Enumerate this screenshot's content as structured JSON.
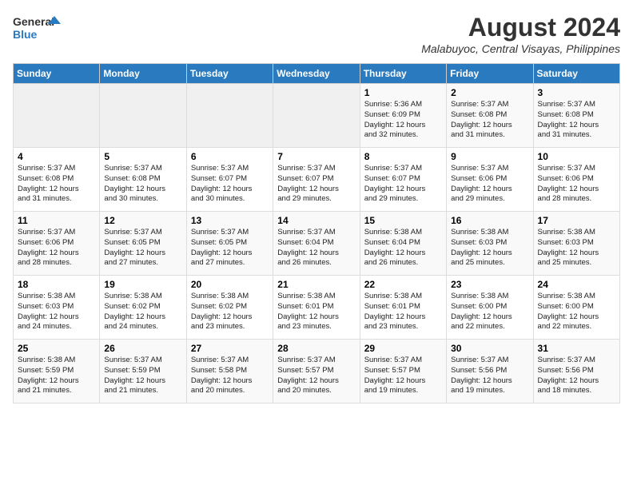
{
  "header": {
    "logo_line1": "General",
    "logo_line2": "Blue",
    "month_year": "August 2024",
    "location": "Malabuyoc, Central Visayas, Philippines"
  },
  "weekdays": [
    "Sunday",
    "Monday",
    "Tuesday",
    "Wednesday",
    "Thursday",
    "Friday",
    "Saturday"
  ],
  "weeks": [
    [
      {
        "day": "",
        "info": ""
      },
      {
        "day": "",
        "info": ""
      },
      {
        "day": "",
        "info": ""
      },
      {
        "day": "",
        "info": ""
      },
      {
        "day": "1",
        "info": "Sunrise: 5:36 AM\nSunset: 6:09 PM\nDaylight: 12 hours\nand 32 minutes."
      },
      {
        "day": "2",
        "info": "Sunrise: 5:37 AM\nSunset: 6:08 PM\nDaylight: 12 hours\nand 31 minutes."
      },
      {
        "day": "3",
        "info": "Sunrise: 5:37 AM\nSunset: 6:08 PM\nDaylight: 12 hours\nand 31 minutes."
      }
    ],
    [
      {
        "day": "4",
        "info": "Sunrise: 5:37 AM\nSunset: 6:08 PM\nDaylight: 12 hours\nand 31 minutes."
      },
      {
        "day": "5",
        "info": "Sunrise: 5:37 AM\nSunset: 6:08 PM\nDaylight: 12 hours\nand 30 minutes."
      },
      {
        "day": "6",
        "info": "Sunrise: 5:37 AM\nSunset: 6:07 PM\nDaylight: 12 hours\nand 30 minutes."
      },
      {
        "day": "7",
        "info": "Sunrise: 5:37 AM\nSunset: 6:07 PM\nDaylight: 12 hours\nand 29 minutes."
      },
      {
        "day": "8",
        "info": "Sunrise: 5:37 AM\nSunset: 6:07 PM\nDaylight: 12 hours\nand 29 minutes."
      },
      {
        "day": "9",
        "info": "Sunrise: 5:37 AM\nSunset: 6:06 PM\nDaylight: 12 hours\nand 29 minutes."
      },
      {
        "day": "10",
        "info": "Sunrise: 5:37 AM\nSunset: 6:06 PM\nDaylight: 12 hours\nand 28 minutes."
      }
    ],
    [
      {
        "day": "11",
        "info": "Sunrise: 5:37 AM\nSunset: 6:06 PM\nDaylight: 12 hours\nand 28 minutes."
      },
      {
        "day": "12",
        "info": "Sunrise: 5:37 AM\nSunset: 6:05 PM\nDaylight: 12 hours\nand 27 minutes."
      },
      {
        "day": "13",
        "info": "Sunrise: 5:37 AM\nSunset: 6:05 PM\nDaylight: 12 hours\nand 27 minutes."
      },
      {
        "day": "14",
        "info": "Sunrise: 5:37 AM\nSunset: 6:04 PM\nDaylight: 12 hours\nand 26 minutes."
      },
      {
        "day": "15",
        "info": "Sunrise: 5:38 AM\nSunset: 6:04 PM\nDaylight: 12 hours\nand 26 minutes."
      },
      {
        "day": "16",
        "info": "Sunrise: 5:38 AM\nSunset: 6:03 PM\nDaylight: 12 hours\nand 25 minutes."
      },
      {
        "day": "17",
        "info": "Sunrise: 5:38 AM\nSunset: 6:03 PM\nDaylight: 12 hours\nand 25 minutes."
      }
    ],
    [
      {
        "day": "18",
        "info": "Sunrise: 5:38 AM\nSunset: 6:03 PM\nDaylight: 12 hours\nand 24 minutes."
      },
      {
        "day": "19",
        "info": "Sunrise: 5:38 AM\nSunset: 6:02 PM\nDaylight: 12 hours\nand 24 minutes."
      },
      {
        "day": "20",
        "info": "Sunrise: 5:38 AM\nSunset: 6:02 PM\nDaylight: 12 hours\nand 23 minutes."
      },
      {
        "day": "21",
        "info": "Sunrise: 5:38 AM\nSunset: 6:01 PM\nDaylight: 12 hours\nand 23 minutes."
      },
      {
        "day": "22",
        "info": "Sunrise: 5:38 AM\nSunset: 6:01 PM\nDaylight: 12 hours\nand 23 minutes."
      },
      {
        "day": "23",
        "info": "Sunrise: 5:38 AM\nSunset: 6:00 PM\nDaylight: 12 hours\nand 22 minutes."
      },
      {
        "day": "24",
        "info": "Sunrise: 5:38 AM\nSunset: 6:00 PM\nDaylight: 12 hours\nand 22 minutes."
      }
    ],
    [
      {
        "day": "25",
        "info": "Sunrise: 5:38 AM\nSunset: 5:59 PM\nDaylight: 12 hours\nand 21 minutes."
      },
      {
        "day": "26",
        "info": "Sunrise: 5:37 AM\nSunset: 5:59 PM\nDaylight: 12 hours\nand 21 minutes."
      },
      {
        "day": "27",
        "info": "Sunrise: 5:37 AM\nSunset: 5:58 PM\nDaylight: 12 hours\nand 20 minutes."
      },
      {
        "day": "28",
        "info": "Sunrise: 5:37 AM\nSunset: 5:57 PM\nDaylight: 12 hours\nand 20 minutes."
      },
      {
        "day": "29",
        "info": "Sunrise: 5:37 AM\nSunset: 5:57 PM\nDaylight: 12 hours\nand 19 minutes."
      },
      {
        "day": "30",
        "info": "Sunrise: 5:37 AM\nSunset: 5:56 PM\nDaylight: 12 hours\nand 19 minutes."
      },
      {
        "day": "31",
        "info": "Sunrise: 5:37 AM\nSunset: 5:56 PM\nDaylight: 12 hours\nand 18 minutes."
      }
    ]
  ]
}
